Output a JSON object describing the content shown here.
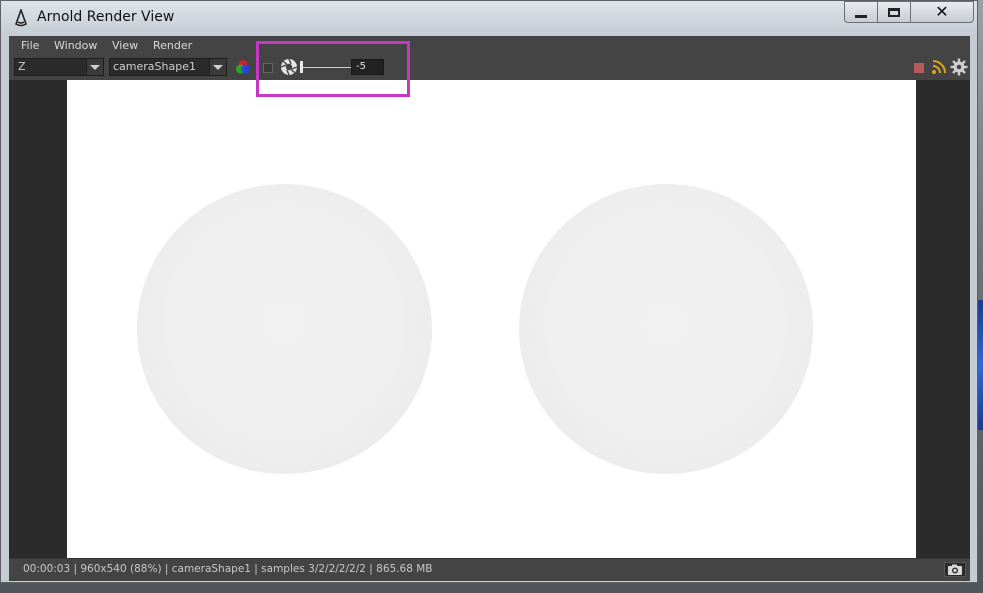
{
  "window": {
    "title": "Arnold Render View"
  },
  "menu": {
    "items": [
      "File",
      "Window",
      "View",
      "Render"
    ]
  },
  "toolbar": {
    "channel_select": "Z",
    "camera_select": "cameraShape1",
    "exposure_value": "-5",
    "exposure_level": 0.0
  },
  "status": {
    "text": "00:00:03 | 960x540 (88%) | cameraShape1  | samples 3/2/2/2/2/2 | 865.68 MB"
  },
  "icons": {
    "title": "arnold-logo-icon",
    "color": "color-wheel-icon",
    "aperture": "aperture-icon",
    "stop": "stop-icon",
    "ipr": "ipr-feed-icon",
    "settings": "gear-icon",
    "snapshot": "camera-icon"
  },
  "colors": {
    "highlight": "#c836c6",
    "stop_button": "#b85a5a",
    "panel": "#444444",
    "render_bg": "#ffffff"
  }
}
